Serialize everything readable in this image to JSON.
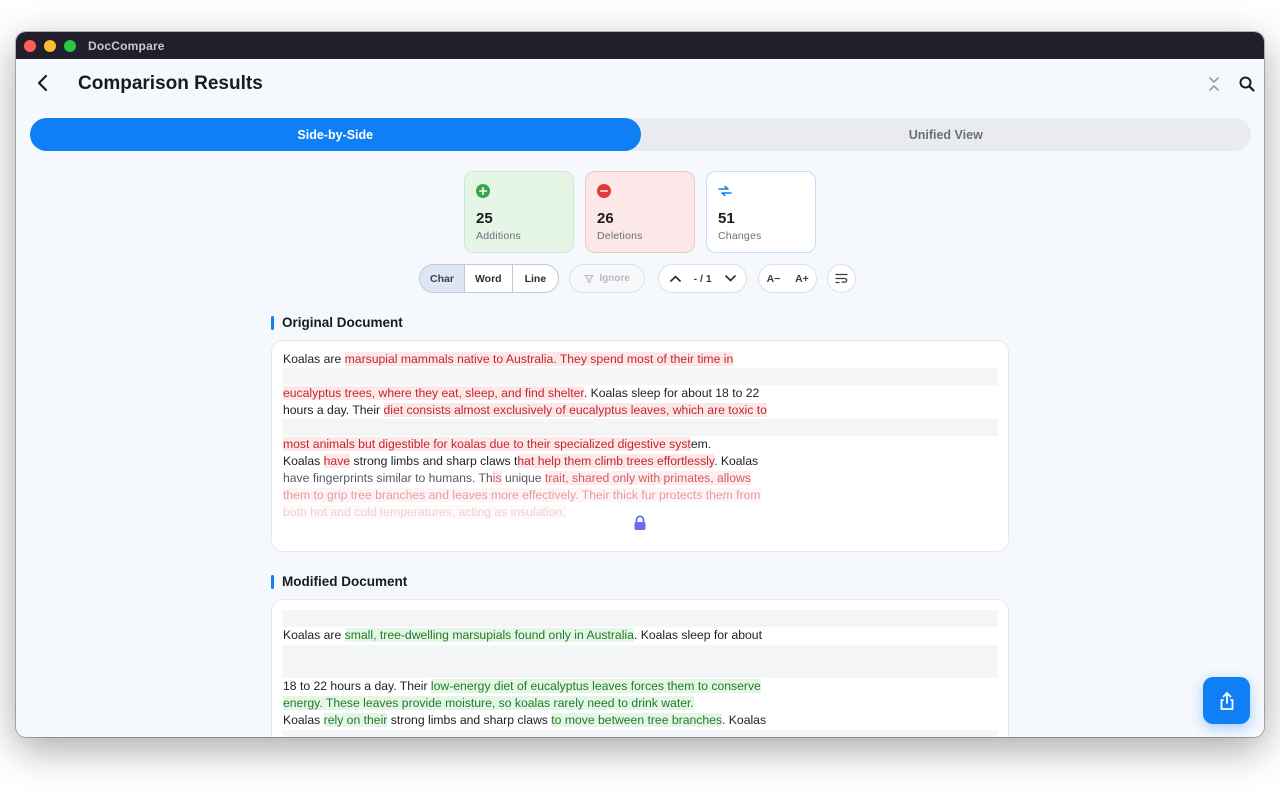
{
  "window": {
    "app_title": "DocCompare"
  },
  "header": {
    "title": "Comparison Results"
  },
  "tabs": [
    {
      "label": "Side-by-Side",
      "active": true
    },
    {
      "label": "Unified View",
      "active": false
    }
  ],
  "stats": {
    "additions": {
      "count": "25",
      "label": "Additions",
      "color": "#3aa54a",
      "icon": "plus-circle-icon"
    },
    "deletions": {
      "count": "26",
      "label": "Deletions",
      "color": "#e53935",
      "icon": "minus-circle-icon"
    },
    "changes": {
      "count": "51",
      "label": "Changes",
      "color": "#0f7ff5",
      "icon": "swap-arrows-icon"
    }
  },
  "toolbar": {
    "granularity": [
      "Char",
      "Word",
      "Line"
    ],
    "granularity_selected": "Char",
    "ignore_label": "Ignore",
    "nav_count": "- / 1",
    "font_decrease": "A−",
    "font_increase": "A+"
  },
  "original": {
    "title": "Original Document",
    "l1a": "Koalas are ",
    "l1b": "marsupial mammals native to Australia. They spend most of their time in",
    "l2a": "eucalyptus trees, where they eat, sleep, and find shelter",
    "l2b": ". Koalas sleep for about 18 to 22",
    "l3a": "hours a day. Their ",
    "l3b": "diet consists almost exclusively of eucalyptus leaves, which are toxic to",
    "l4a": "most animals but digestible for koalas due to their specialized digestive syst",
    "l4b": "em.",
    "l5a": "Koalas ",
    "l5b": "have",
    "l5c": " strong limbs and sharp claws t",
    "l5d": "hat help them climb trees effortlessly",
    "l5e": ". Koalas",
    "l6a": "have fingerprints similar to humans. Th",
    "l6b": "is",
    "l6c": " unique ",
    "l6d": "trait, shared only with primates, allows",
    "l7": "them to grip tree branches and leaves more effectively. Their thick fur protects them from",
    "l8": "both hot and cold temperatures, acting as insulation."
  },
  "modified": {
    "title": "Modified Document",
    "l1a": "Koalas are ",
    "l1b": "small, tree-dwelling marsupials found only in Australia",
    "l1c": ". Koalas sleep for about",
    "l2a": "18 to 22 hours a day. Their ",
    "l2b": "low-energy diet of eucalyptus leaves forces them to conserve",
    "l3": "energy. These leaves provide moisture, so koalas rarely need to drink water.",
    "l4a": "Koalas ",
    "l4b": "rely on their",
    "l4c": " strong limbs and sharp claws ",
    "l4d": "to move between tree branches",
    "l4e": ". Koalas"
  }
}
